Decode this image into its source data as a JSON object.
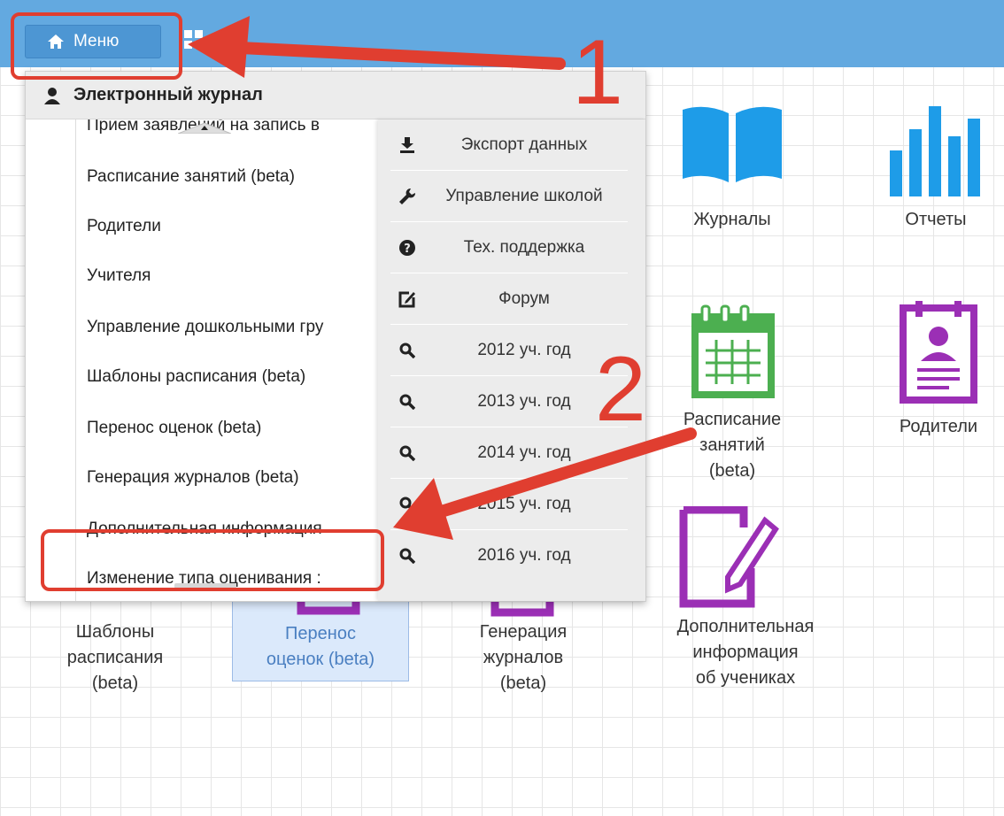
{
  "topbar": {
    "menu_label": "Меню"
  },
  "tiles": {
    "journals": "Журналы",
    "reports": "Отчеты",
    "schedule": [
      "Расписание",
      "занятий",
      "(beta)"
    ],
    "parents": "Родители",
    "templates": [
      "Шаблоны",
      "расписания",
      "(beta)"
    ],
    "transfer": [
      "Перенос",
      "оценок (beta)"
    ],
    "generation": [
      "Генерация",
      "журналов",
      "(beta)"
    ],
    "extra_info": [
      "Дополнительная",
      "информация",
      "об учениках"
    ]
  },
  "dropdown": {
    "title": "Электронный журнал",
    "left_items": [
      "Прием заявлений на запись в",
      "Расписание занятий (beta)",
      "Родители",
      "Учителя",
      "Управление дошкольными гру",
      "Шаблоны расписания (beta)",
      "Перенос оценок (beta)",
      "Генерация журналов (beta)",
      "Дополнительная информация",
      "Изменение типа оценивания :"
    ],
    "right_items": [
      "Экспорт данных",
      "Управление школой",
      "Тех. поддержка",
      "Форум",
      "2012 уч. год",
      "2013 уч. год",
      "2014 уч. год",
      "2015 уч. год",
      "2016 уч. год"
    ]
  },
  "annotations": {
    "step1": "1",
    "step2": "2"
  },
  "colors": {
    "topbar": "#63a9e0",
    "blue_icon": "#1e9ce8",
    "green_icon": "#4caf50",
    "purple_icon": "#9b2fb5",
    "annotation_red": "#e03e30"
  },
  "icons": [
    "home-icon",
    "grid-icon",
    "user-icon",
    "download-icon",
    "wrench-icon",
    "question-circle-icon",
    "edit-icon",
    "search-icon",
    "book-icon",
    "bar-chart-icon",
    "calendar-icon",
    "parent-card-icon",
    "document-edit-icon"
  ]
}
